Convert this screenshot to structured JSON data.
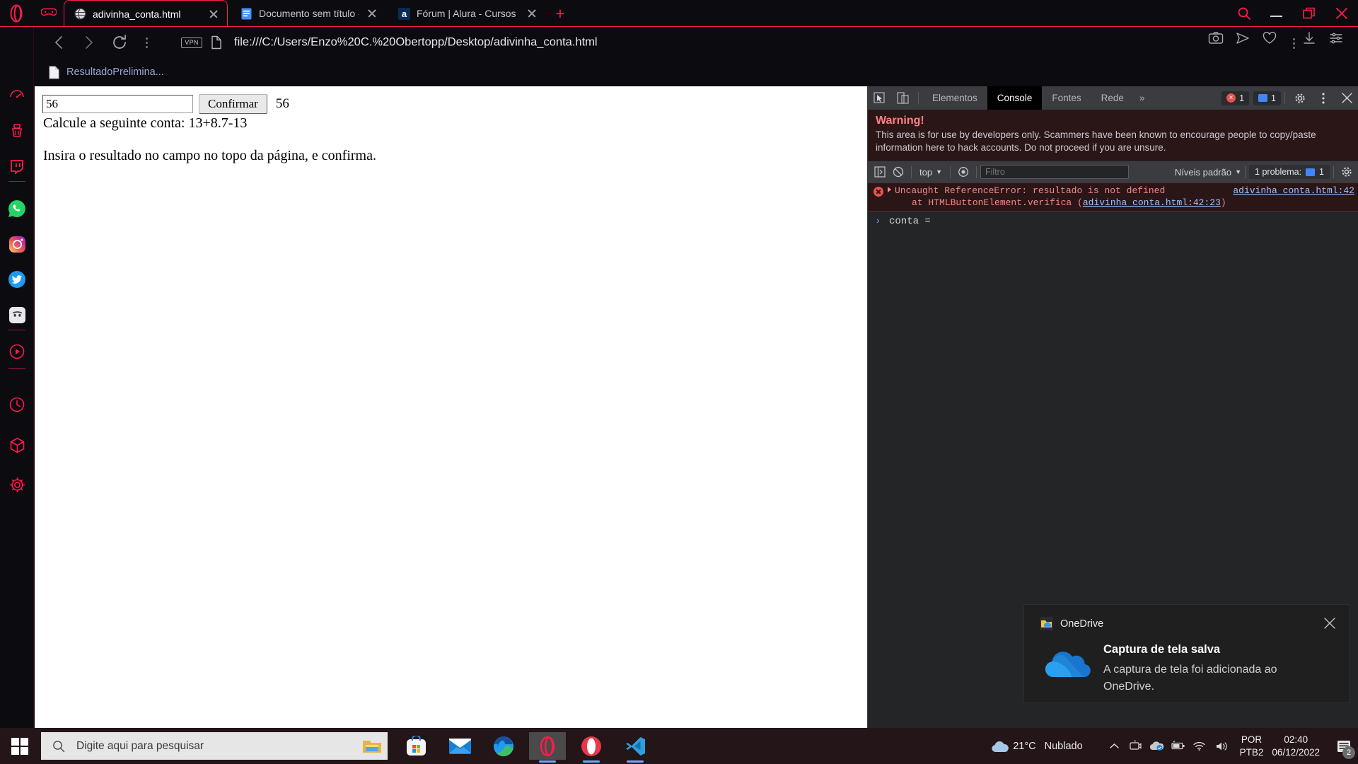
{
  "browser": {
    "name": "Opera GX",
    "tabs": [
      {
        "title": "adivinha_conta.html",
        "favicon": "globe-icon",
        "active": true
      },
      {
        "title": "Documento sem título - Do",
        "favicon": "docs-icon",
        "active": false
      },
      {
        "title": "Fórum | Alura - Cursos onli",
        "favicon": "alura-icon",
        "active": false
      }
    ],
    "new_tab_label": "+",
    "window_controls": [
      "search-icon",
      "minimize-icon",
      "maximize-icon",
      "close-icon"
    ],
    "toolbar": {
      "back": "back-icon",
      "forward": "forward-icon",
      "reload": "reload-icon",
      "vpn_label": "VPN",
      "page_icon": "file-document-icon",
      "url": "file:///C:/Users/Enzo%20C.%20Obertopp/Desktop/adivinha_conta.html",
      "right_icons": [
        "snapshot-camera-icon",
        "flow-send-icon",
        "heart-icon",
        "more-vertical-icon",
        "downloads-icon",
        "easy-setup-icon"
      ]
    },
    "bookmarks": [
      {
        "label": "ResultadoPrelimina...",
        "icon": "file-document-icon"
      }
    ],
    "sidebar": [
      {
        "name": "gx-control",
        "icon": "speedometer-icon"
      },
      {
        "name": "gx-cleaner",
        "icon": "broom-icon"
      },
      {
        "name": "twitch",
        "icon": "twitch-icon"
      },
      {
        "name": "divider-1",
        "icon": "divider"
      },
      {
        "name": "whatsapp",
        "icon": "whatsapp-icon"
      },
      {
        "name": "instagram",
        "icon": "instagram-icon"
      },
      {
        "name": "twitter",
        "icon": "twitter-icon"
      },
      {
        "name": "discord",
        "icon": "discord-icon"
      },
      {
        "name": "divider-2",
        "icon": "divider"
      },
      {
        "name": "player",
        "icon": "play-circle-icon"
      },
      {
        "name": "divider-3",
        "icon": "divider"
      },
      {
        "name": "history",
        "icon": "clock-icon"
      },
      {
        "name": "extensions",
        "icon": "cube-icon"
      },
      {
        "name": "settings",
        "icon": "gear-icon"
      }
    ]
  },
  "page": {
    "input_value": "56",
    "input_placeholder": "",
    "confirm_label": "Confirmar",
    "result_value": "56",
    "line1": "Calcule a seguinte conta: 13+8.7-13",
    "line2": "Insira o resultado no campo no topo da página, e confirma."
  },
  "devtools": {
    "tabs": [
      {
        "label": "Elementos",
        "active": false
      },
      {
        "label": "Console",
        "active": true
      },
      {
        "label": "Fontes",
        "active": false
      },
      {
        "label": "Rede",
        "active": false
      }
    ],
    "overflow_label": "»",
    "error_count": "1",
    "message_count": "1",
    "warning": {
      "title": "Warning!",
      "text": "This area is for use by developers only. Scammers have been known to encourage people to copy/paste information here to hack accounts. Do not proceed if you are unsure."
    },
    "bar": {
      "context_label": "top",
      "filter_placeholder": "Filtro",
      "levels_label": "Níveis padrão",
      "problems_label": "1 problema:",
      "problems_count": "1"
    },
    "console": {
      "error_message": "Uncaught ReferenceError: resultado is not defined",
      "error_source": "adivinha_conta.html:42",
      "stack_prefix": "at HTMLButtonElement.verifica (",
      "stack_link": "adivinha_conta.html:42:23",
      "stack_suffix": ")",
      "prompt_caret": "›",
      "prompt_value": "conta ="
    }
  },
  "toast": {
    "app_name": "OneDrive",
    "title": "Captura de tela salva",
    "body": "A captura de tela foi adicionada ao OneDrive.",
    "close": "close-icon"
  },
  "taskbar": {
    "start": "windows-start-icon",
    "search_placeholder": "Digite aqui para pesquisar",
    "apps": [
      {
        "name": "file-explorer",
        "icon": "folder-icon"
      },
      {
        "name": "microsoft-store",
        "icon": "store-icon"
      },
      {
        "name": "mail",
        "icon": "mail-icon"
      },
      {
        "name": "microsoft-edge",
        "icon": "edge-icon"
      },
      {
        "name": "opera-gx",
        "icon": "opera-gx-icon"
      },
      {
        "name": "opera",
        "icon": "opera-icon"
      },
      {
        "name": "visual-studio-code",
        "icon": "vscode-icon"
      }
    ],
    "weather_temp": "21°C",
    "weather_desc": "Nublado",
    "tray_icons": [
      "chevron-up-icon",
      "camera-icon",
      "onedrive-tray-icon",
      "battery-icon",
      "wifi-icon",
      "volume-icon"
    ],
    "language_line1": "POR",
    "language_line2": "PTB2",
    "clock_time": "02:40",
    "clock_date": "06/12/2022",
    "notification_count": "2"
  },
  "colors": {
    "gx_red": "#ff1b4a",
    "devtools_bg": "#242527",
    "error_bg": "#2b1617",
    "link_blue": "#9fc2ff"
  }
}
